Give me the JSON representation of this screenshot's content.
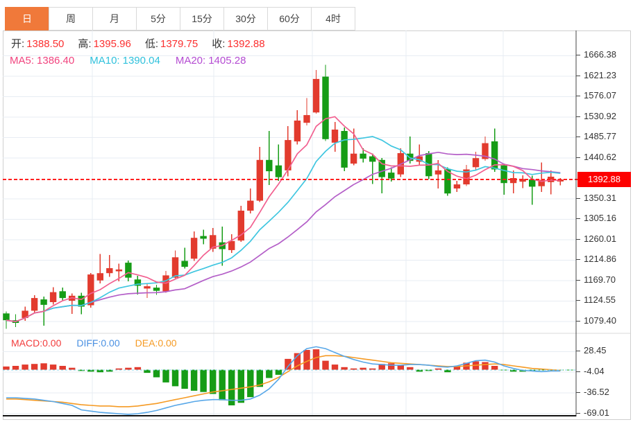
{
  "tabs": {
    "items": [
      {
        "label": "日",
        "active": true
      },
      {
        "label": "周",
        "active": false
      },
      {
        "label": "月",
        "active": false
      },
      {
        "label": "5分",
        "active": false
      },
      {
        "label": "15分",
        "active": false
      },
      {
        "label": "30分",
        "active": false
      },
      {
        "label": "60分",
        "active": false
      },
      {
        "label": "4时",
        "active": false
      }
    ]
  },
  "info_bar": {
    "open_label": "开:",
    "open": "1388.50",
    "high_label": "高:",
    "high": "1395.96",
    "low_label": "低:",
    "low": "1379.75",
    "close_label": "收:",
    "close": "1392.88"
  },
  "ma_bar": {
    "ma5_label": "MA5:",
    "ma5": "1386.40",
    "ma10_label": "MA10:",
    "ma10": "1390.04",
    "ma20_label": "MA20:",
    "ma20": "1405.28"
  },
  "macd_bar": {
    "macd_label": "MACD:",
    "macd": "0.00",
    "diff_label": "DIFF:",
    "diff": "0.00",
    "dea_label": "DEA:",
    "dea": "0.00"
  },
  "price_axis": {
    "current_price": "1392.88",
    "ticks": [
      1666.38,
      1621.23,
      1576.07,
      1530.92,
      1485.77,
      1440.62,
      1350.31,
      1305.16,
      1260.01,
      1214.86,
      1169.7,
      1124.55,
      1079.4
    ]
  },
  "colors": {
    "up": "#e23b2e",
    "down": "#169c16",
    "ma5_line": "#f25f8f",
    "ma10_line": "#3fc6e0",
    "ma20_line": "#b45fc8",
    "diff_line": "#57a7e8",
    "dea_line": "#f59a23",
    "current_price_line": "#ff1f1f",
    "current_price_tag": "#fd0100",
    "diff_dashed_line": "#86d7ec",
    "tab_active": "#f0793a",
    "grid": "#e7ecf3"
  },
  "chart_data": {
    "type": "candlestick",
    "panels": [
      "price",
      "macd"
    ],
    "price_ylim": [
      1056,
      1668
    ],
    "price_ticks": [
      1666.38,
      1621.23,
      1576.07,
      1530.92,
      1485.77,
      1440.62,
      1350.31,
      1305.16,
      1260.01,
      1214.86,
      1169.7,
      1124.55,
      1079.4
    ],
    "current_price": 1392.88,
    "candles_ohlc": [
      [
        1097,
        1101,
        1063,
        1082
      ],
      [
        1082,
        1095,
        1067,
        1076
      ],
      [
        1087,
        1112,
        1081,
        1103
      ],
      [
        1103,
        1137,
        1099,
        1131
      ],
      [
        1128,
        1134,
        1070,
        1116
      ],
      [
        1122,
        1155,
        1117,
        1144
      ],
      [
        1146,
        1154,
        1126,
        1131
      ],
      [
        1125,
        1141,
        1096,
        1136
      ],
      [
        1136,
        1143,
        1095,
        1112
      ],
      [
        1115,
        1186,
        1110,
        1183
      ],
      [
        1170,
        1228,
        1163,
        1186
      ],
      [
        1186,
        1226,
        1178,
        1197
      ],
      [
        1190,
        1207,
        1168,
        1194
      ],
      [
        1209,
        1214,
        1168,
        1176
      ],
      [
        1172,
        1180,
        1139,
        1158
      ],
      [
        1152,
        1163,
        1131,
        1157
      ],
      [
        1154,
        1160,
        1138,
        1147
      ],
      [
        1146,
        1191,
        1143,
        1181
      ],
      [
        1176,
        1236,
        1172,
        1221
      ],
      [
        1213,
        1242,
        1196,
        1200
      ],
      [
        1218,
        1278,
        1213,
        1264
      ],
      [
        1268,
        1282,
        1250,
        1262
      ],
      [
        1240,
        1286,
        1233,
        1270
      ],
      [
        1254,
        1289,
        1202,
        1239
      ],
      [
        1237,
        1272,
        1231,
        1257
      ],
      [
        1258,
        1335,
        1255,
        1324
      ],
      [
        1324,
        1373,
        1318,
        1346
      ],
      [
        1346,
        1465,
        1343,
        1436
      ],
      [
        1436,
        1500,
        1381,
        1411
      ],
      [
        1424,
        1470,
        1390,
        1398
      ],
      [
        1413,
        1511,
        1400,
        1480
      ],
      [
        1477,
        1546,
        1470,
        1523
      ],
      [
        1518,
        1573,
        1512,
        1535
      ],
      [
        1541,
        1635,
        1538,
        1615
      ],
      [
        1620,
        1646,
        1478,
        1482
      ],
      [
        1474,
        1520,
        1454,
        1503
      ],
      [
        1500,
        1508,
        1411,
        1419
      ],
      [
        1428,
        1505,
        1424,
        1450
      ],
      [
        1450,
        1462,
        1430,
        1439
      ],
      [
        1444,
        1450,
        1383,
        1432
      ],
      [
        1436,
        1440,
        1362,
        1398
      ],
      [
        1408,
        1420,
        1388,
        1395
      ],
      [
        1404,
        1462,
        1398,
        1451
      ],
      [
        1450,
        1488,
        1428,
        1434
      ],
      [
        1432,
        1470,
        1426,
        1444
      ],
      [
        1451,
        1456,
        1394,
        1400
      ],
      [
        1404,
        1436,
        1373,
        1413
      ],
      [
        1416,
        1420,
        1357,
        1362
      ],
      [
        1373,
        1390,
        1365,
        1382
      ],
      [
        1382,
        1425,
        1378,
        1415
      ],
      [
        1420,
        1454,
        1412,
        1440
      ],
      [
        1438,
        1488,
        1434,
        1473
      ],
      [
        1477,
        1505,
        1410,
        1415
      ],
      [
        1424,
        1428,
        1359,
        1385
      ],
      [
        1385,
        1413,
        1362,
        1396
      ],
      [
        1388,
        1402,
        1374,
        1394
      ],
      [
        1393,
        1401,
        1337,
        1377
      ],
      [
        1378,
        1430,
        1365,
        1392
      ],
      [
        1387,
        1413,
        1360,
        1399
      ],
      [
        1388.5,
        1395.96,
        1379.75,
        1392.88
      ]
    ],
    "moving_averages": [
      {
        "name": "MA5",
        "period": 5,
        "last_value": 1386.4
      },
      {
        "name": "MA10",
        "period": 10,
        "last_value": 1390.04
      },
      {
        "name": "MA20",
        "period": 20,
        "last_value": 1405.28
      }
    ],
    "macd": {
      "ticks": [
        28.45,
        -4.04,
        -36.52,
        -69.01
      ],
      "ylim": [
        -80,
        40
      ],
      "hist": [
        5,
        6,
        8,
        9,
        10,
        8,
        6,
        3,
        -2,
        -3,
        -4,
        -3,
        2,
        3,
        4,
        -5,
        -12,
        -20,
        -26,
        -30,
        -33,
        -35,
        -38,
        -48,
        -56,
        -52,
        -43,
        -27,
        -13,
        -8,
        17,
        26,
        31,
        32,
        14,
        8,
        4,
        2,
        3,
        2,
        9,
        10,
        7,
        4,
        -3,
        -2,
        2,
        -4,
        6,
        11,
        13,
        12,
        6,
        -1,
        -3,
        -3,
        -2,
        -1,
        -1,
        -0.5,
        -0.5
      ],
      "diff": [
        -44,
        -44,
        -45,
        -46,
        -48,
        -50,
        -53,
        -56,
        -63,
        -65,
        -67,
        -68,
        -69,
        -70,
        -69,
        -67,
        -64,
        -60,
        -56,
        -53,
        -50,
        -48,
        -47,
        -47,
        -48,
        -48,
        -46,
        -40,
        -30,
        -15,
        5,
        22,
        33,
        36,
        33,
        27,
        21,
        16,
        12,
        9,
        8,
        7,
        7,
        8,
        8,
        7,
        5,
        4,
        6,
        10,
        14,
        15,
        12,
        6,
        2,
        -1,
        -2,
        -3,
        -2,
        -2
      ],
      "dea": [
        -46,
        -46,
        -47,
        -48,
        -49,
        -50,
        -51,
        -53,
        -55,
        -56,
        -57,
        -57,
        -58,
        -58,
        -57,
        -55,
        -53,
        -50,
        -47,
        -44,
        -41,
        -38,
        -35,
        -33,
        -31,
        -29,
        -27,
        -24,
        -19,
        -12,
        -3,
        6,
        13,
        19,
        22,
        22,
        21,
        19,
        17,
        15,
        13,
        11,
        10,
        9,
        8,
        7,
        6,
        5,
        5,
        6,
        7,
        8,
        9,
        8,
        6,
        4,
        2,
        1,
        0,
        -1
      ]
    }
  }
}
